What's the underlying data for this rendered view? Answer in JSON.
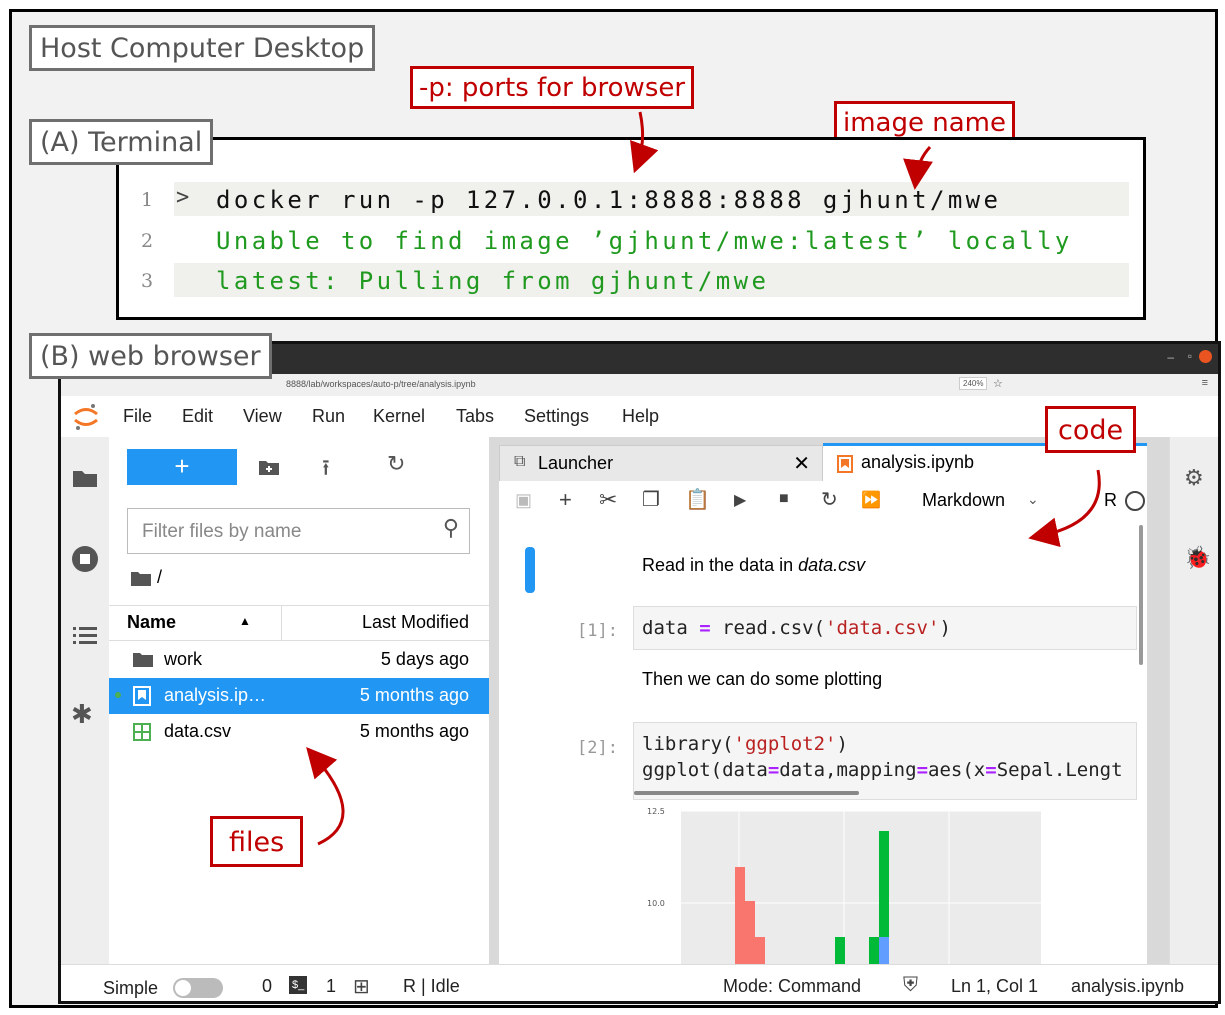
{
  "labels": {
    "host": "Host Computer Desktop",
    "terminal": "(A) Terminal",
    "browser": "(B) web browser",
    "ports": "-p: ports for browser",
    "image_name": "image name",
    "code": "code",
    "files": "files"
  },
  "terminal": {
    "prompt": ">",
    "lines": [
      {
        "num": "1",
        "text": "docker run -p 127.0.0.1:8888:8888 gjhunt/mwe"
      },
      {
        "num": "2",
        "text": "Unable to find image ’gjhunt/mwe:latest’ locally"
      },
      {
        "num": "3",
        "text": "latest: Pulling from gjhunt/mwe"
      }
    ]
  },
  "browser": {
    "url": "8888/lab/workspaces/auto-p/tree/analysis.ipynb",
    "zoom": "240%",
    "menus": [
      "File",
      "Edit",
      "View",
      "Run",
      "Kernel",
      "Tabs",
      "Settings",
      "Help"
    ],
    "filter_placeholder": "Filter files by name",
    "path": "/",
    "columns": {
      "name": "Name",
      "modified": "Last Modified"
    },
    "files": [
      {
        "name": "work",
        "modified": "5 days ago",
        "icon": "folder-icon"
      },
      {
        "name": "analysis.ip…",
        "modified": "5 months ago",
        "icon": "notebook-icon"
      },
      {
        "name": "data.csv",
        "modified": "5 months ago",
        "icon": "table-icon"
      }
    ],
    "tabs": {
      "launcher": "Launcher",
      "notebook": "analysis.ipynb"
    },
    "cell_type": "Markdown",
    "kernel": "R",
    "cells": {
      "md1_pre": "Read in the data in ",
      "md1_em": "data.csv",
      "prompt1": "[1]:",
      "prompt2": "[2]:",
      "md2": "Then we can do some plotting"
    },
    "status": {
      "simple": "Simple",
      "terminals": "0",
      "kernels": "1",
      "kernel_state": "R | Idle",
      "mode": "Mode: Command",
      "position": "Ln 1, Col 1",
      "file": "analysis.ipynb"
    }
  },
  "chart_data": {
    "type": "bar",
    "yticks": [
      "10.0",
      "12.5"
    ]
  },
  "colors": {
    "annotation": "#c00000",
    "selection": "#2196f3",
    "terminal_output": "#1f9a1f"
  }
}
